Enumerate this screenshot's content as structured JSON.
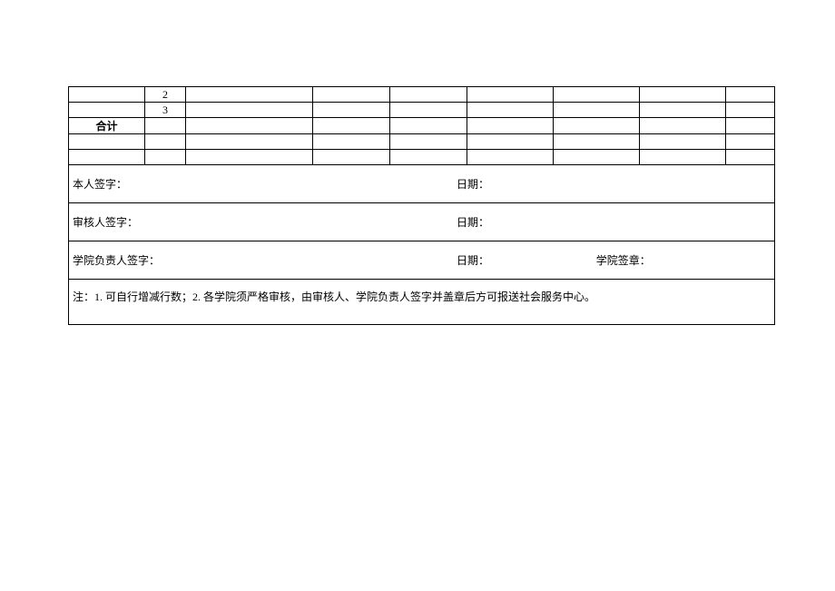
{
  "table": {
    "row_numbers": [
      "2",
      "3"
    ],
    "total_label": "合计"
  },
  "signatures": {
    "self_label": "本人签字：",
    "self_date_label": "日期：",
    "reviewer_label": "审核人签字：",
    "reviewer_date_label": "日期：",
    "dean_label": "学院负责人签字：",
    "dean_date_label": "日期：",
    "dean_seal_label": "学院签章："
  },
  "note": "注：1. 可自行增减行数；2. 各学院须严格审核，由审核人、学院负责人签字并盖章后方可报送社会服务中心。"
}
